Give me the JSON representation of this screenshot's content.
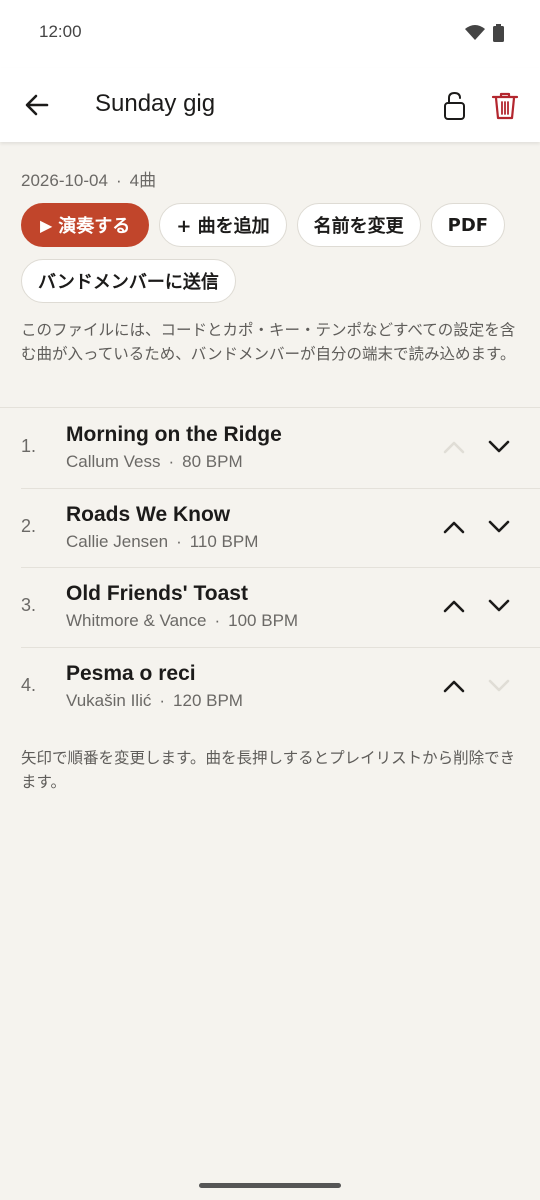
{
  "status": {
    "time": "12:00"
  },
  "header": {
    "title": "Sunday gig"
  },
  "meta": {
    "date": "2026-10-04",
    "count": "4曲"
  },
  "actions": {
    "play": "演奏する",
    "add_song": "+ 曲を追加",
    "rename": "名前を変更",
    "pdf": "PDF",
    "send_band": "バンドメンバーに送信"
  },
  "note": "このファイルには、コードとカポ・キー・テンポなどすべての設定を含む曲が入っているため、バンドメンバーが自分の端末で読み込めます。",
  "songs": [
    {
      "num": "1.",
      "title": "Morning on the Ridge",
      "artist": "Callum Vess",
      "bpm": "80 BPM"
    },
    {
      "num": "2.",
      "title": "Roads We Know",
      "artist": "Callie Jensen",
      "bpm": "110 BPM"
    },
    {
      "num": "3.",
      "title": "Old Friends' Toast",
      "artist": "Whitmore & Vance",
      "bpm": "100 BPM"
    },
    {
      "num": "4.",
      "title": "Pesma o reci",
      "artist": "Vukašin Ilić",
      "bpm": "120 BPM"
    }
  ],
  "hint": "矢印で順番を変更します。曲を長押しするとプレイリストから削除できます。",
  "colors": {
    "accent": "#c1452b",
    "trash": "#b3262e",
    "background": "#f5f3ee"
  },
  "icons": [
    "back-arrow-icon",
    "lock-open-icon",
    "trash-icon",
    "play-icon",
    "chevron-up-icon",
    "chevron-down-icon",
    "wifi-icon",
    "battery-icon"
  ]
}
